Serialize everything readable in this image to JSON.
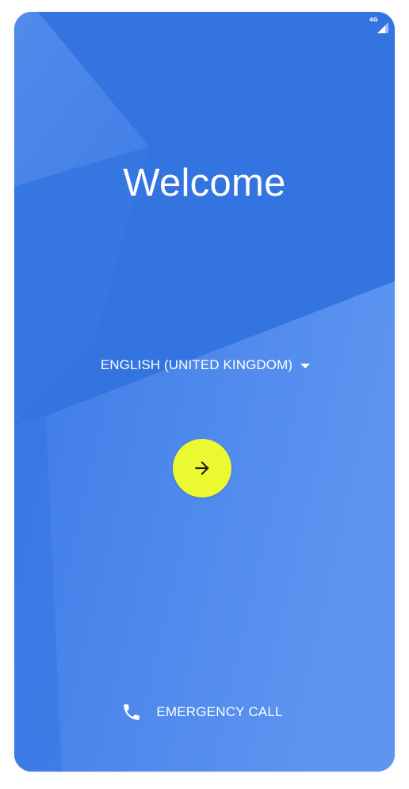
{
  "status_bar": {
    "network_label": "4G",
    "icon": "signal-icon"
  },
  "welcome": {
    "title": "Welcome"
  },
  "language": {
    "selected": "ENGLISH (UNITED KINGDOM)",
    "icon": "caret-down-icon"
  },
  "next": {
    "icon": "arrow-right-icon"
  },
  "emergency": {
    "label": "EMERGENCY CALL",
    "icon": "phone-icon"
  },
  "colors": {
    "background": "#3474e0",
    "background_light": "#5a92ef",
    "accent": "#eaf930",
    "text": "#ffffff"
  }
}
